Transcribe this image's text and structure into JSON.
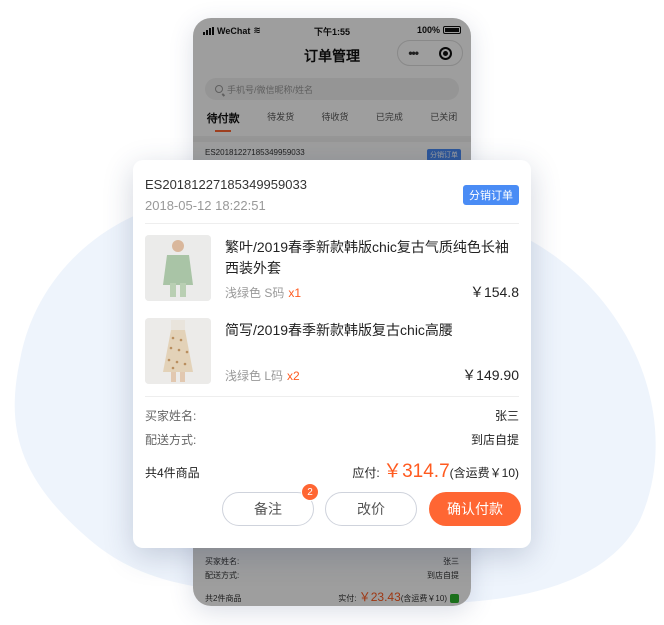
{
  "status_bar": {
    "carrier": "WeChat",
    "time": "下午1:55",
    "battery": "100%"
  },
  "nav": {
    "title": "订单管理"
  },
  "search": {
    "placeholder": "手机号/微信昵称/姓名"
  },
  "tabs": [
    {
      "label": "待付款",
      "active": true
    },
    {
      "label": "待发货",
      "active": false
    },
    {
      "label": "待收货",
      "active": false
    },
    {
      "label": "已完成",
      "active": false
    },
    {
      "label": "已关闭",
      "active": false
    }
  ],
  "bg_order_top": {
    "order_no": "ES20181227185349959033",
    "tag": "分销订单"
  },
  "bg_order_bottom": {
    "buyer_label": "买家姓名:",
    "buyer_value": "张三",
    "delivery_label": "配送方式:",
    "delivery_value": "到店自提",
    "count": "共2件商品",
    "paid_label": "实付:",
    "paid_amount": "￥23.43",
    "freight": "(含运费￥10)"
  },
  "card": {
    "order_no": "ES20181227185349959033",
    "order_time": "2018-05-12 18:22:51",
    "badge": "分销订单",
    "products": [
      {
        "name": "繁叶/2019春季新款韩版chic复古气质纯色长袖西装外套",
        "spec": "浅绿色 S码",
        "qty": "x1",
        "price": "￥154.8"
      },
      {
        "name": "简写/2019春季新款韩版复古chic高腰",
        "spec": "浅绿色 L码",
        "qty": "x2",
        "price": "￥149.90"
      }
    ],
    "buyer_label": "买家姓名:",
    "buyer_value": "张三",
    "delivery_label": "配送方式:",
    "delivery_value": "到店自提",
    "total_count": "共4件商品",
    "payable_label": "应付:",
    "payable_amount": "￥314.7",
    "freight": "(含运费￥10)",
    "buttons": {
      "remark": "备注",
      "remark_badge": "2",
      "change_price": "改价",
      "confirm": "确认付款"
    }
  },
  "colors": {
    "accent": "#ff6633",
    "badge_blue": "#4a8cf5",
    "price": "#ff5a1f"
  }
}
